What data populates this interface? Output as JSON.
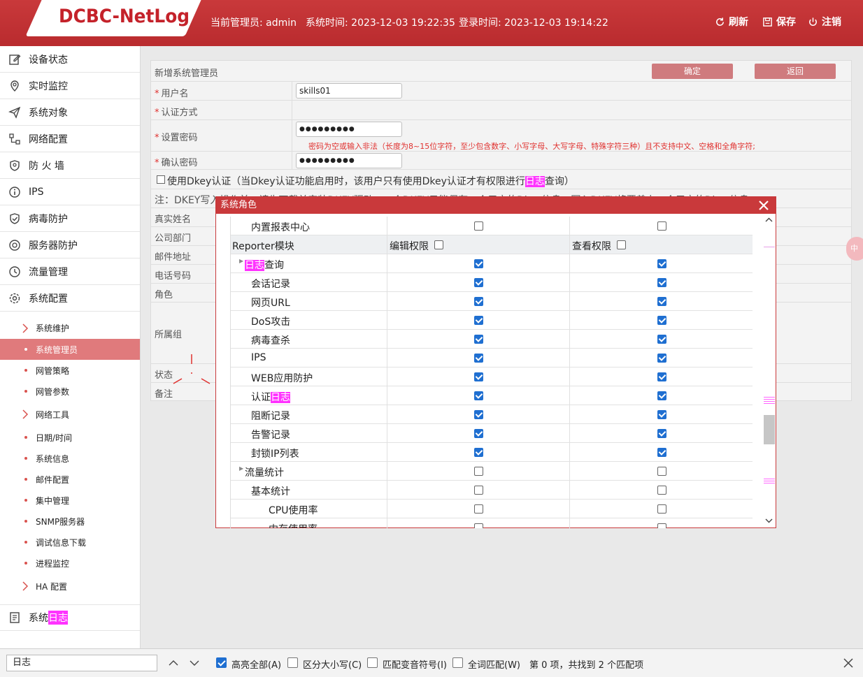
{
  "header": {
    "logo": "DCBC-NetLog",
    "admin": "当前管理员: admin",
    "system_time": "系统时间: 2023-12-03 19:22:35",
    "login_time": "登录时间: 2023-12-03 19:14:22",
    "refresh": "刷新",
    "save": "保存",
    "logout": "注销"
  },
  "sidebar": {
    "items": [
      {
        "label": "设备状态",
        "icon": "edit-icon"
      },
      {
        "label": "实时监控",
        "icon": "location-icon"
      },
      {
        "label": "系统对象",
        "icon": "send-icon"
      },
      {
        "label": "网络配置",
        "icon": "network-icon"
      },
      {
        "label": "防 火 墙",
        "icon": "shield-icon"
      },
      {
        "label": "IPS",
        "icon": "info-icon"
      },
      {
        "label": "病毒防护",
        "icon": "shield-check-icon"
      },
      {
        "label": "服务器防护",
        "icon": "target-icon"
      },
      {
        "label": "流量管理",
        "icon": "clock-icon"
      },
      {
        "label": "系统配置",
        "icon": "gear-icon"
      }
    ],
    "sub_items": [
      {
        "label": "系统维护",
        "type": "chevron"
      },
      {
        "label": "系统管理员",
        "type": "dot"
      },
      {
        "label": "网管策略",
        "type": "dot"
      },
      {
        "label": "网管参数",
        "type": "dot"
      },
      {
        "label": "网络工具",
        "type": "chevron"
      },
      {
        "label": "日期/时间",
        "type": "dot"
      },
      {
        "label": "系统信息",
        "type": "dot"
      },
      {
        "label": "邮件配置",
        "type": "dot"
      },
      {
        "label": "集中管理",
        "type": "dot"
      },
      {
        "label": "SNMP服务器",
        "type": "dot"
      },
      {
        "label": "调试信息下载",
        "type": "dot"
      },
      {
        "label": "进程监控",
        "type": "dot"
      },
      {
        "label": "HA 配置",
        "type": "chevron"
      }
    ],
    "syslog_prefix": "系统",
    "syslog_highlight": "日志"
  },
  "form": {
    "title": "新增系统管理员",
    "confirm": "确定",
    "back": "返回",
    "username_label": "用户名",
    "username_value": "skills01",
    "auth_label": "认证方式",
    "password_label": "设置密码",
    "password_value": "●●●●●●●●●",
    "password_hint": "密码为空或输入非法（长度为8~15位字符，至少包含数字、小写字母、大写字母、特殊字符三种）且不支持中文、空格和全角字符;",
    "confirm_password_label": "确认密码",
    "confirm_password_value": "●●●●●●●●●",
    "dkey_text_a": "使用Dkey认证（当Dkey认证功能启用时，该用户只有使用Dkey认证才有权限进行",
    "dkey_hl": "日志",
    "dkey_text_b": "查询）",
    "note": "注：DKEY写入操作前，请先下载并安装DKEY驱动；一个DKEY只能保存一个用户的Dkey信息，写入DKEY将覆盖上一个用户的Dkey信息",
    "realname_label": "真实姓名",
    "dept_label": "公司部门",
    "email_label": "邮件地址",
    "phone_label": "电话号码",
    "role_label": "角色",
    "group_label": "所属组",
    "status_label": "状态",
    "remark_label": "备注"
  },
  "modal": {
    "title": "系统角色",
    "header_module": "Reporter模块",
    "header_edit": "编辑权限",
    "header_view": "查看权限",
    "rows_top": [
      {
        "name": "内置报表中心",
        "indent": 1,
        "edit": false,
        "view": false
      }
    ],
    "rows": [
      {
        "name_hl": "日志",
        "name": "查询",
        "indent": 0,
        "tri": true,
        "edit": true,
        "view": true
      },
      {
        "name": "会话记录",
        "indent": 1,
        "edit": true,
        "view": true
      },
      {
        "name": "网页URL",
        "indent": 1,
        "edit": true,
        "view": true
      },
      {
        "name": "DoS攻击",
        "indent": 1,
        "edit": true,
        "view": true
      },
      {
        "name": "病毒查杀",
        "indent": 1,
        "edit": true,
        "view": true
      },
      {
        "name": "IPS",
        "indent": 1,
        "edit": true,
        "view": true
      },
      {
        "name": "WEB应用防护",
        "indent": 1,
        "edit": true,
        "view": true
      },
      {
        "name": "认证",
        "name_hl_after": "日志",
        "indent": 1,
        "edit": true,
        "view": true
      },
      {
        "name": "阻断记录",
        "indent": 1,
        "edit": true,
        "view": true
      },
      {
        "name": "告警记录",
        "indent": 1,
        "edit": true,
        "view": true
      },
      {
        "name": "封锁IP列表",
        "indent": 1,
        "edit": true,
        "view": true
      },
      {
        "name": "流量统计",
        "indent": 0,
        "tri": true,
        "edit": false,
        "view": false
      },
      {
        "name": "基本统计",
        "indent": 1,
        "edit": false,
        "view": false
      },
      {
        "name": "CPU使用率",
        "indent": 2,
        "edit": false,
        "view": false
      },
      {
        "name": "内存使用率",
        "indent": 2,
        "edit": false,
        "view": false
      }
    ]
  },
  "findbar": {
    "query": "日志",
    "highlight_all": "高亮全部(A)",
    "match_case": "区分大小写(C)",
    "match_diacritics": "匹配变音符号(I)",
    "whole_words": "全词匹配(W)",
    "status": "第 0 项，共找到 2 个匹配项"
  },
  "colors": {
    "header_red": "#c9393b",
    "highlight": "#ff33ff",
    "active_sub": "#e07a7c",
    "checkbox_blue": "#1f6fd1"
  }
}
